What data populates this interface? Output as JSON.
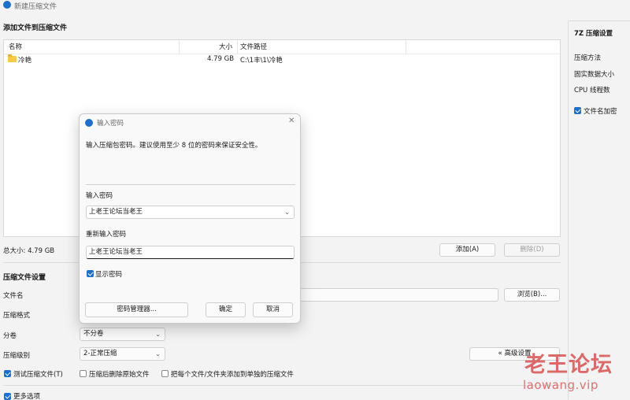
{
  "window": {
    "title": "新建压缩文件"
  },
  "files_section": {
    "heading": "添加文件到压缩文件",
    "columns": [
      "名称",
      "大小",
      "文件路径"
    ],
    "rows": [
      {
        "name": "冷艳",
        "size": "4.79 GB",
        "path": "C:\\1丰\\1\\冷艳"
      }
    ],
    "total_size": "总大小: 4.79 GB",
    "add_button": "添加(A)",
    "remove_button": "删除(D)"
  },
  "compress_settings": {
    "heading": "压缩文件设置",
    "filename_label": "文件名",
    "format_label": "压缩格式",
    "split_label": "分卷",
    "split_value": "不分卷",
    "level_label": "压缩级别",
    "level_value": "2-正常压缩",
    "browse_button": "浏览(B)...",
    "advanced_button": "« 高级设置",
    "test_checkbox": "测试压缩文件(T)",
    "delete_after_checkbox": "压缩后删除原始文件",
    "separate_checkbox": "把每个文件/文件夹添加到单独的压缩文件",
    "more_options": "更多选项"
  },
  "right_panel": {
    "heading": "7Z 压缩设置",
    "method_label": "压缩方法",
    "solid_label": "固实数据大小",
    "cpu_label": "CPU 线程数",
    "encrypt_names": "文件名加密"
  },
  "password_dialog": {
    "title": "输入密码",
    "description": "输入压缩包密码。建议使用至少 8 位的密码来保证安全性。",
    "enter_label": "输入密码",
    "enter_value": "上老王论坛当老王",
    "reenter_label": "重新输入密码",
    "reenter_value": "上老王论坛当老王",
    "show_password": "显示密码",
    "manager_button": "密码管理器...",
    "ok_button": "确定",
    "cancel_button": "取消"
  },
  "watermark": {
    "cn": "老王论坛",
    "en": "laowang.vip"
  },
  "colors": {
    "accent": "#1e6fc9",
    "watermark": "#d64b4b"
  },
  "icons": [
    "app-icon",
    "folder-icon",
    "close-icon",
    "chevron-down-icon",
    "checkbox-checked-icon"
  ]
}
